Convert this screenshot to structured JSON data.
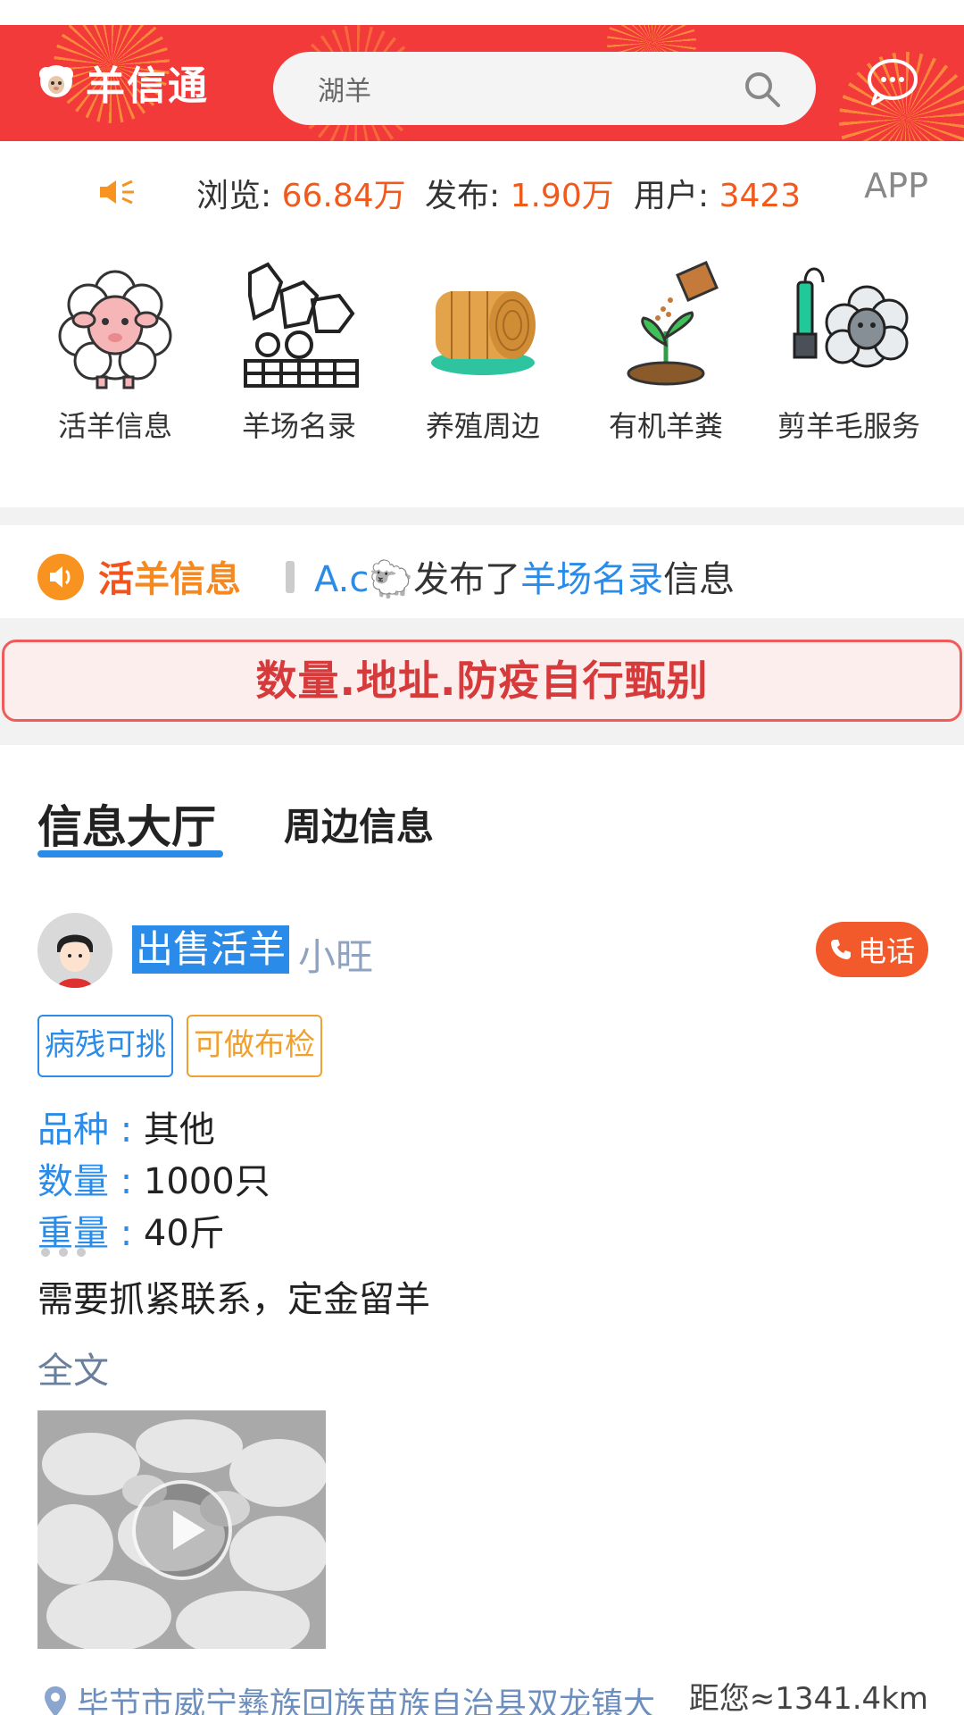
{
  "header": {
    "app_name": "羊信通",
    "search_value": "湖羊"
  },
  "stats": {
    "views_label": "浏览: ",
    "views_value": "66.84万",
    "posts_label": "发布: ",
    "posts_value": "1.90万",
    "users_label": "用户: ",
    "users_value": "3423",
    "app_link": "APP"
  },
  "categories": [
    {
      "label": "活羊信息",
      "icon": "sheep-icon"
    },
    {
      "label": "羊场名录",
      "icon": "farm-animals-icon"
    },
    {
      "label": "养殖周边",
      "icon": "hay-bale-icon"
    },
    {
      "label": "有机羊粪",
      "icon": "fertilizer-sprout-icon"
    },
    {
      "label": "剪羊毛服务",
      "icon": "shearing-icon"
    }
  ],
  "ticker": {
    "title_first": "活",
    "title_rest": "羊信息",
    "user": "A.c🐑",
    "action": "发布了",
    "category": "羊场名录",
    "suffix": "信息"
  },
  "notice": "数量.地址.防疫自行甄别",
  "tabs": {
    "active": "信息大厅",
    "second": "周边信息"
  },
  "post": {
    "tag": "出售活羊",
    "user": "小旺",
    "call_label": "电话",
    "chips": [
      "病残可挑",
      "可做布检"
    ],
    "fields": [
      {
        "key": "品种",
        "value": "其他"
      },
      {
        "key": "数量",
        "value": "1000只"
      },
      {
        "key": "重量",
        "value": "40斤"
      }
    ],
    "description": "需要抓紧联系，定金留羊",
    "full_text_link": "全文",
    "location": "毕节市威宁彝族回族苗族自治县双龙镇大",
    "distance": "距您≈1341.4km"
  },
  "colors": {
    "header_red": "#f33a3a",
    "accent_blue": "#2a8be8",
    "stat_orange": "#f05a1d",
    "call_red": "#f25a2c"
  }
}
